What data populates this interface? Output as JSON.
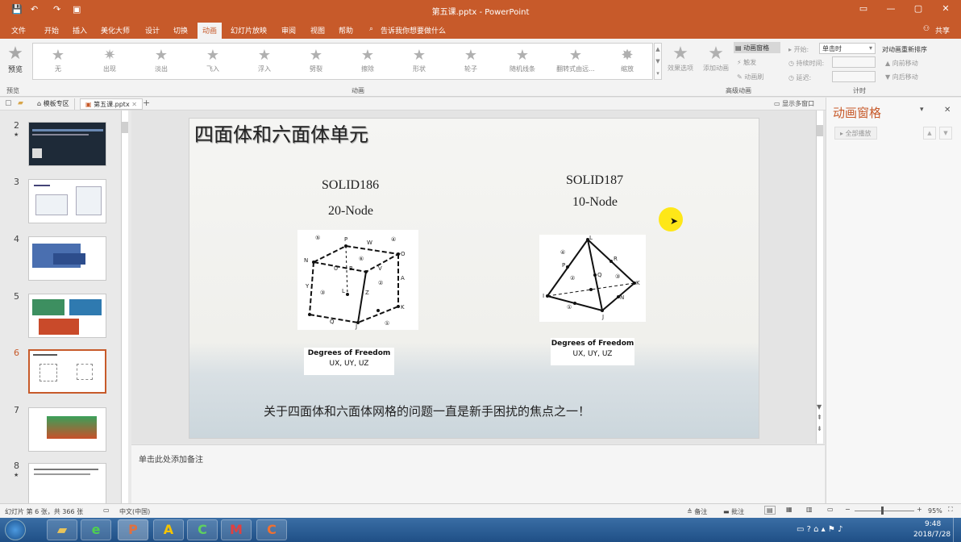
{
  "window": {
    "title": "第五课.pptx - PowerPoint"
  },
  "tabs": [
    "文件",
    "开始",
    "插入",
    "美化大师",
    "设计",
    "切换",
    "动画",
    "幻灯片放映",
    "审阅",
    "视图",
    "帮助"
  ],
  "tell_me": "告诉我你想要做什么",
  "share": "共享",
  "ribbon": {
    "preview": "预览",
    "preview_group": "预览",
    "animations": [
      "无",
      "出现",
      "淡出",
      "飞入",
      "浮入",
      "劈裂",
      "擦除",
      "形状",
      "轮子",
      "随机线条",
      "翻转式由远...",
      "缩放"
    ],
    "effect_options": "效果选项",
    "anim_group": "动画",
    "add_anim": "添加动画",
    "anim_pane_btn": "动画窗格",
    "trigger": "触发",
    "anim_painter": "动画刷",
    "adv_group": "高级动画",
    "start_label": "开始:",
    "start_value": "单击时",
    "duration_label": "持续时间:",
    "delay_label": "延迟:",
    "reorder": "对动画重新排序",
    "move_earlier": "向前移动",
    "move_later": "向后移动",
    "timing_group": "计时"
  },
  "docbar": {
    "tab1": "模板专区",
    "tab2": "第五课.pptx",
    "show_multi": "显示多窗口"
  },
  "thumbnails": [
    {
      "num": "2",
      "star": "★"
    },
    {
      "num": "3",
      "star": ""
    },
    {
      "num": "4",
      "star": ""
    },
    {
      "num": "5",
      "star": ""
    },
    {
      "num": "6",
      "star": ""
    },
    {
      "num": "7",
      "star": ""
    },
    {
      "num": "8",
      "star": "★"
    }
  ],
  "slide": {
    "title": "四面体和六面体单元",
    "left_name": "SOLID186",
    "left_nodes": "20-Node",
    "right_name": "SOLID187",
    "right_nodes": "10-Node",
    "dof_title": "Degrees of Freedom",
    "dof_values": "UX, UY, UZ",
    "caption": "关于四面体和六面体网格的问题一直是新手困扰的焦点之一！"
  },
  "notes_placeholder": "单击此处添加备注",
  "anim_pane": {
    "title": "动画窗格",
    "play_all": "全部播放"
  },
  "status": {
    "slide_info": "幻灯片 第 6 张，共 366 张",
    "lang": "中文(中国)",
    "notes": "备注",
    "comments": "批注",
    "zoom": "95%"
  },
  "clock": {
    "time": "9:48",
    "date": "2018/7/28"
  },
  "colors": {
    "accent": "#c75a2a",
    "highlight": "#ffe600"
  }
}
